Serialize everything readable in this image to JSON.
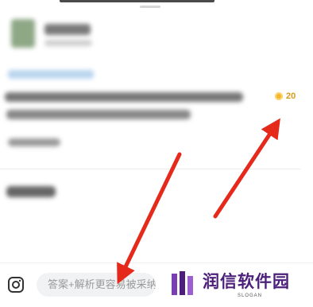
{
  "question": {
    "reward_points": "20"
  },
  "bottom_bar": {
    "answer_placeholder": "答案+解析更容易被采纳"
  },
  "watermark": {
    "brand_name": "润信软件园",
    "slogan": "SLOGAN"
  },
  "colors": {
    "annotation_arrow": "#e52a1c",
    "coin": "#f4b62c",
    "brand": "#4b1f7a"
  },
  "icons": {
    "camera": "camera-icon",
    "coin": "coin-icon"
  }
}
